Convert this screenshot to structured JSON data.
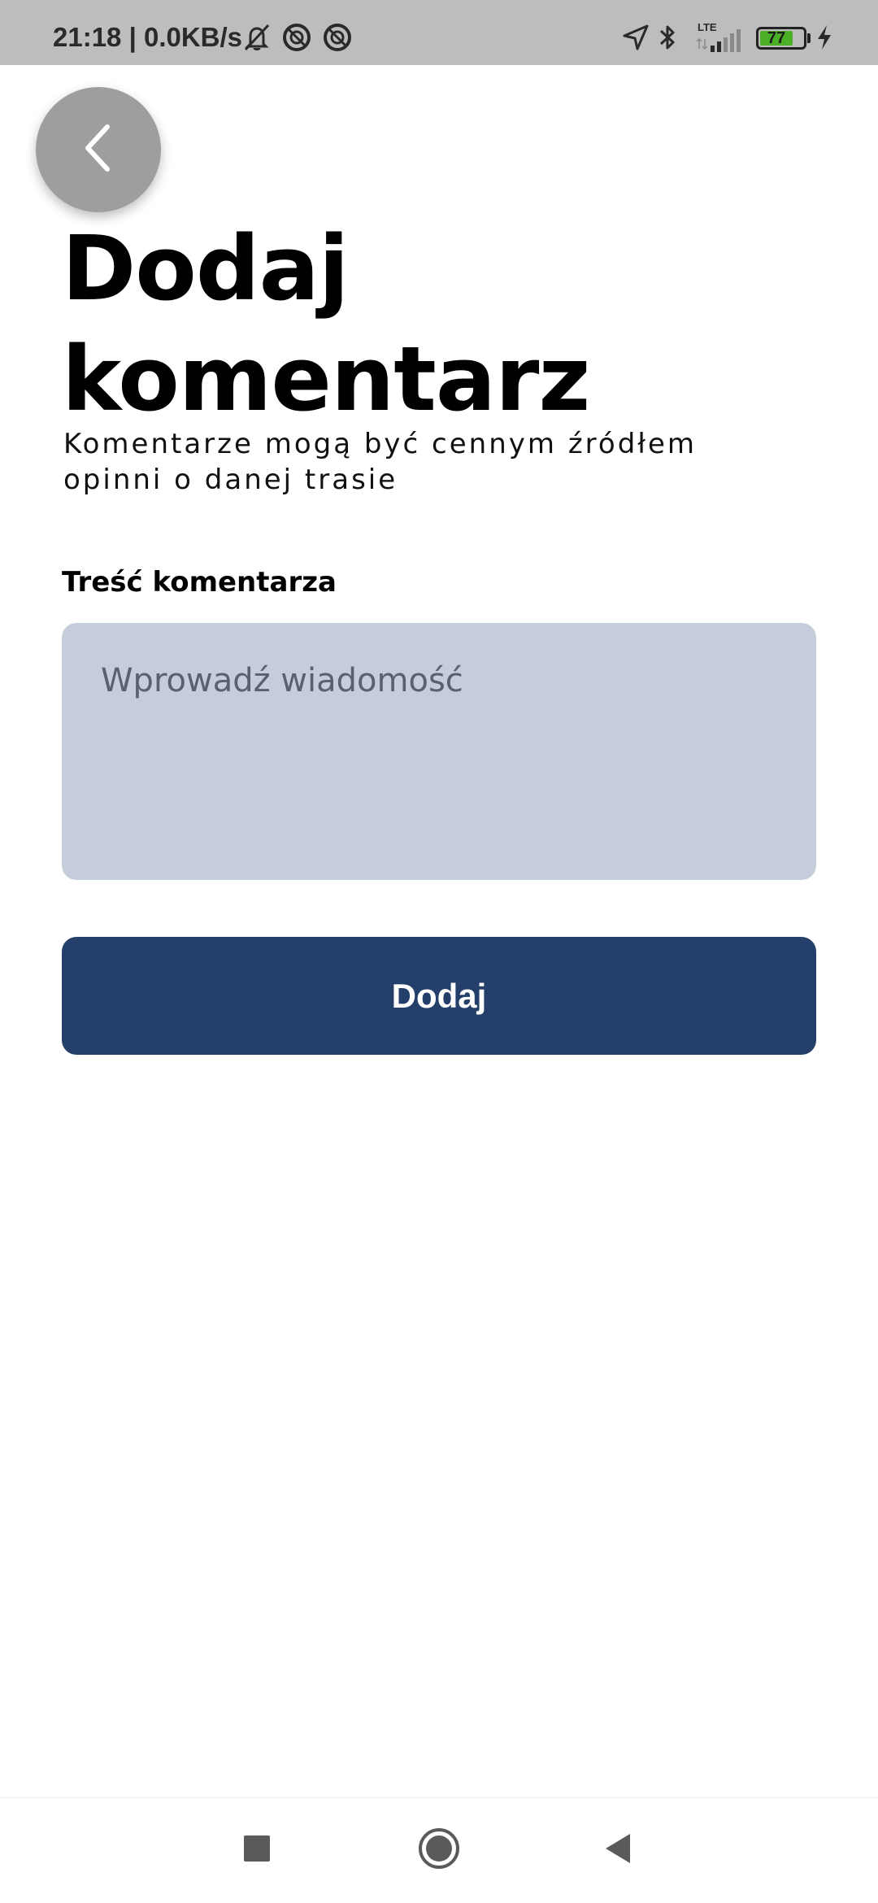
{
  "status_bar": {
    "left_text": "21:18 | 0.0KB/s",
    "network_type": "LTE",
    "battery_level": "77",
    "battery_fraction": 0.77,
    "icons": [
      "muted-bell-icon",
      "blocked-circle-icon",
      "blocked-circle-icon",
      "location-arrow-icon",
      "bluetooth-icon",
      "signal-bars-icon",
      "battery-icon",
      "charging-bolt-icon"
    ]
  },
  "header": {
    "back_icon": "chevron-left-icon",
    "title": "Dodaj komentarz",
    "subtitle": "Komentarze mogą być cennym źródłem opinni o danej trasie"
  },
  "form": {
    "field_label": "Treść komentarza",
    "message_value": "",
    "message_placeholder": "Wprowadź wiadomość",
    "submit_label": "Dodaj"
  },
  "nav_bar": {
    "icons": [
      "recents-square-icon",
      "home-circle-icon",
      "back-triangle-icon"
    ]
  },
  "colors": {
    "status_bar_bg": "#bdbdbd",
    "back_button_bg": "#9e9e9e",
    "input_bg": "#c5ccda",
    "button_bg": "#24406a",
    "button_text": "#ffffff",
    "battery_green": "#4caf28"
  }
}
